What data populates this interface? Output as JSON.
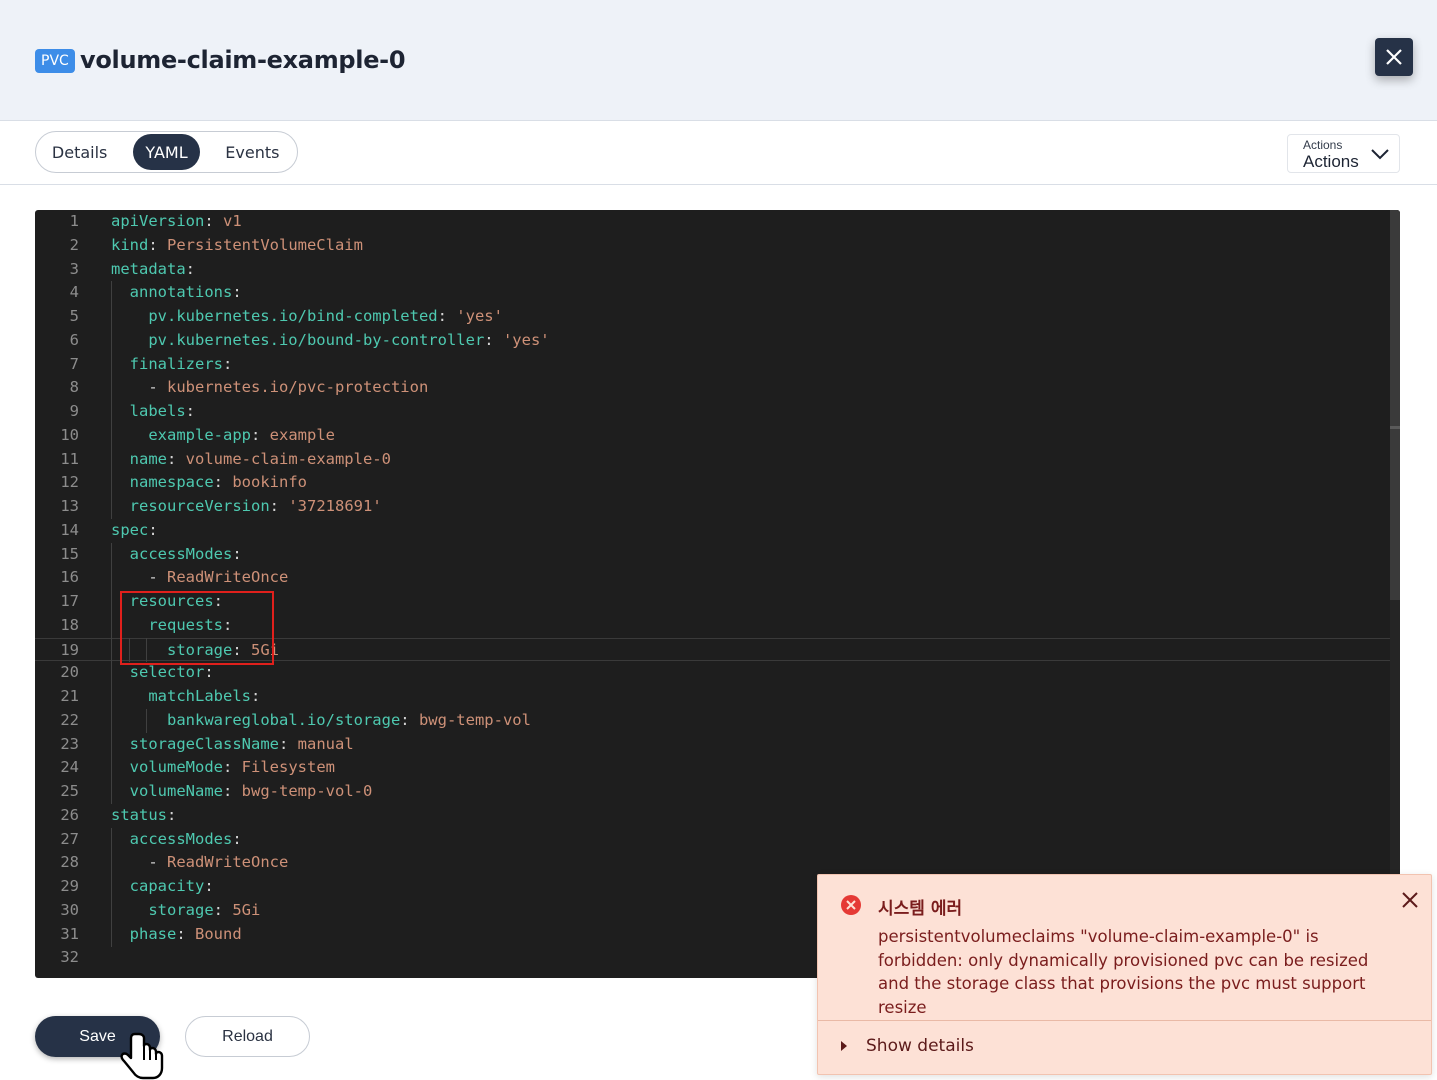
{
  "header": {
    "badge": "PVC",
    "title": "volume-claim-example-0",
    "close_icon": "close-icon"
  },
  "tabs": [
    {
      "label": "Details",
      "active": false
    },
    {
      "label": "YAML",
      "active": true
    },
    {
      "label": "Events",
      "active": false
    }
  ],
  "actions": {
    "small_label": "Actions",
    "label": "Actions",
    "icon": "chevron-down-icon"
  },
  "editor": {
    "lines": [
      [
        [
          "k",
          "apiVersion"
        ],
        [
          "p",
          ": "
        ],
        [
          "v",
          "v1"
        ]
      ],
      [
        [
          "k",
          "kind"
        ],
        [
          "p",
          ": "
        ],
        [
          "v",
          "PersistentVolumeClaim"
        ]
      ],
      [
        [
          "k",
          "metadata"
        ],
        [
          "p",
          ":"
        ]
      ],
      [
        [
          "p",
          "  "
        ],
        [
          "k",
          "annotations"
        ],
        [
          "p",
          ":"
        ]
      ],
      [
        [
          "p",
          "    "
        ],
        [
          "k",
          "pv.kubernetes.io/bind-completed"
        ],
        [
          "p",
          ": "
        ],
        [
          "v",
          "'yes'"
        ]
      ],
      [
        [
          "p",
          "    "
        ],
        [
          "k",
          "pv.kubernetes.io/bound-by-controller"
        ],
        [
          "p",
          ": "
        ],
        [
          "v",
          "'yes'"
        ]
      ],
      [
        [
          "p",
          "  "
        ],
        [
          "k",
          "finalizers"
        ],
        [
          "p",
          ":"
        ]
      ],
      [
        [
          "p",
          "    - "
        ],
        [
          "v",
          "kubernetes.io/pvc-protection"
        ]
      ],
      [
        [
          "p",
          "  "
        ],
        [
          "k",
          "labels"
        ],
        [
          "p",
          ":"
        ]
      ],
      [
        [
          "p",
          "    "
        ],
        [
          "k",
          "example-app"
        ],
        [
          "p",
          ": "
        ],
        [
          "v",
          "example"
        ]
      ],
      [
        [
          "p",
          "  "
        ],
        [
          "k",
          "name"
        ],
        [
          "p",
          ": "
        ],
        [
          "v",
          "volume-claim-example-0"
        ]
      ],
      [
        [
          "p",
          "  "
        ],
        [
          "k",
          "namespace"
        ],
        [
          "p",
          ": "
        ],
        [
          "v",
          "bookinfo"
        ]
      ],
      [
        [
          "p",
          "  "
        ],
        [
          "k",
          "resourceVersion"
        ],
        [
          "p",
          ": "
        ],
        [
          "v",
          "'37218691'"
        ]
      ],
      [
        [
          "k",
          "spec"
        ],
        [
          "p",
          ":"
        ]
      ],
      [
        [
          "p",
          "  "
        ],
        [
          "k",
          "accessModes"
        ],
        [
          "p",
          ":"
        ]
      ],
      [
        [
          "p",
          "    - "
        ],
        [
          "v",
          "ReadWriteOnce"
        ]
      ],
      [
        [
          "p",
          "  "
        ],
        [
          "k",
          "resources"
        ],
        [
          "p",
          ":"
        ]
      ],
      [
        [
          "p",
          "    "
        ],
        [
          "k",
          "requests"
        ],
        [
          "p",
          ":"
        ]
      ],
      [
        [
          "p",
          "      "
        ],
        [
          "k",
          "storage"
        ],
        [
          "p",
          ": "
        ],
        [
          "v",
          "5Gi"
        ]
      ],
      [
        [
          "p",
          "  "
        ],
        [
          "k",
          "selector"
        ],
        [
          "p",
          ":"
        ]
      ],
      [
        [
          "p",
          "    "
        ],
        [
          "k",
          "matchLabels"
        ],
        [
          "p",
          ":"
        ]
      ],
      [
        [
          "p",
          "      "
        ],
        [
          "k",
          "bankwareglobal.io/storage"
        ],
        [
          "p",
          ": "
        ],
        [
          "v",
          "bwg-temp-vol"
        ]
      ],
      [
        [
          "p",
          "  "
        ],
        [
          "k",
          "storageClassName"
        ],
        [
          "p",
          ": "
        ],
        [
          "v",
          "manual"
        ]
      ],
      [
        [
          "p",
          "  "
        ],
        [
          "k",
          "volumeMode"
        ],
        [
          "p",
          ": "
        ],
        [
          "v",
          "Filesystem"
        ]
      ],
      [
        [
          "p",
          "  "
        ],
        [
          "k",
          "volumeName"
        ],
        [
          "p",
          ": "
        ],
        [
          "v",
          "bwg-temp-vol-0"
        ]
      ],
      [
        [
          "k",
          "status"
        ],
        [
          "p",
          ":"
        ]
      ],
      [
        [
          "p",
          "  "
        ],
        [
          "k",
          "accessModes"
        ],
        [
          "p",
          ":"
        ]
      ],
      [
        [
          "p",
          "    - "
        ],
        [
          "v",
          "ReadWriteOnce"
        ]
      ],
      [
        [
          "p",
          "  "
        ],
        [
          "k",
          "capacity"
        ],
        [
          "p",
          ":"
        ]
      ],
      [
        [
          "p",
          "    "
        ],
        [
          "k",
          "storage"
        ],
        [
          "p",
          ": "
        ],
        [
          "v",
          "5Gi"
        ]
      ],
      [
        [
          "p",
          "  "
        ],
        [
          "k",
          "phase"
        ],
        [
          "p",
          ": "
        ],
        [
          "v",
          "Bound"
        ]
      ],
      []
    ],
    "current_line": 19,
    "highlighted_lines": [
      17,
      19
    ]
  },
  "buttons": {
    "save": "Save",
    "reload": "Reload"
  },
  "toast": {
    "title": "시스템 에러",
    "message": "persistentvolumeclaims \"volume-claim-example-0\" is forbidden: only dynamically provisioned pvc can be resized and the storage class that provisions the pvc must support resize",
    "details_label": "Show details",
    "icon": "error-circle-icon",
    "close_icon": "close-icon"
  },
  "colors": {
    "key": "#4ec9b0",
    "value": "#ce9178",
    "editor_bg": "#1e1e1e",
    "primary": "#263247",
    "badge": "#3d8de8",
    "toast_bg": "#fde1d6",
    "error": "#e53935",
    "highlight": "#e0201c"
  }
}
